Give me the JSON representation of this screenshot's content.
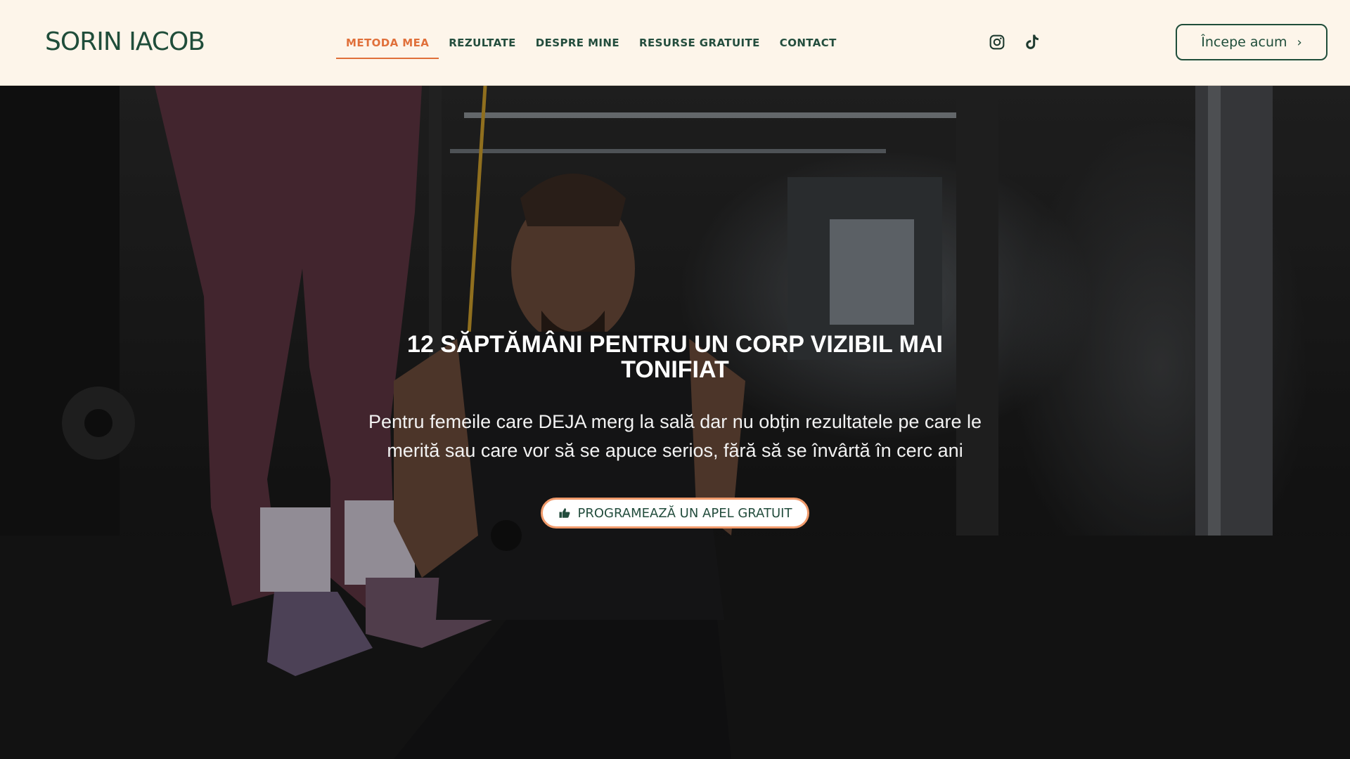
{
  "header": {
    "logo": "SORIN IACOB",
    "nav": [
      {
        "label": "METODA MEA",
        "active": true
      },
      {
        "label": "REZULTATE",
        "active": false
      },
      {
        "label": "DESPRE MINE",
        "active": false
      },
      {
        "label": "RESURSE GRATUITE",
        "active": false
      },
      {
        "label": "CONTACT",
        "active": false
      }
    ],
    "social_icons": [
      "instagram-icon",
      "tiktok-icon"
    ],
    "cta_label": "Începe acum",
    "cta_icon": "chevron-right-icon"
  },
  "hero": {
    "title": "12 SĂPTĂMÂNI PENTRU UN CORP VIZIBIL MAI TONIFIAT",
    "subtitle": "Pentru femeile care DEJA merg la sală dar nu obțin rezultatele pe care le merită sau care vor să se apuce serios, fără să se învârtă în cerc ani",
    "cta_label": "PROGRAMEAZĂ UN APEL GRATUIT",
    "cta_icon": "thumbs-up-icon"
  },
  "colors": {
    "header_bg": "#fdf5ea",
    "brand_green": "#1f4d3a",
    "accent_orange": "#e0703a",
    "cta_border": "#f09a6b"
  }
}
